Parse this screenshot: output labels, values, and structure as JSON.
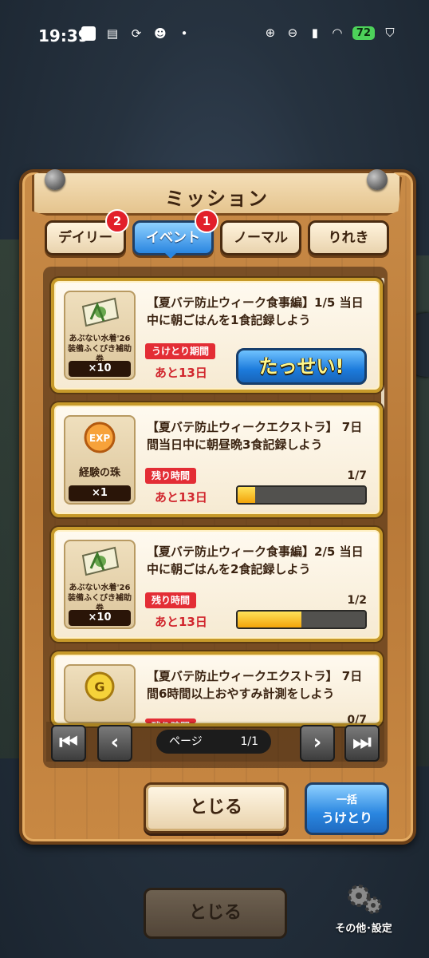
{
  "status_bar": {
    "time": "19:39",
    "battery": "72"
  },
  "dialog": {
    "title": "ミッション",
    "tabs": [
      {
        "label": "デイリー",
        "badge": "2",
        "active": false
      },
      {
        "label": "イベント",
        "badge": "1",
        "active": true
      },
      {
        "label": "ノーマル",
        "active": false
      },
      {
        "label": "りれき",
        "active": false
      }
    ],
    "missions": [
      {
        "reward_name": "あぶない水着'26 装備ふくびき補助券",
        "reward_qty": "×10",
        "text": "【夏バテ防止ウィーク食事編】1/5 当日中に朝ごはんを1食記録しよう",
        "tag": "うけとり期間",
        "remaining": "あと13日",
        "claim_label": "たっせい!",
        "claimable": true
      },
      {
        "reward_name": "経験の珠",
        "reward_qty": "×1",
        "reward_icon_text": "EXP",
        "text": "【夏バテ防止ウィークエクストラ】 7日間当日中に朝昼晩3食記録しよう",
        "tag": "残り時間",
        "remaining": "あと13日",
        "progress_text": "1/7",
        "progress": 0.14
      },
      {
        "reward_name": "あぶない水着'26 装備ふくびき補助券",
        "reward_qty": "×10",
        "text": "【夏バテ防止ウィーク食事編】2/5 当日中に朝ごはんを2食記録しよう",
        "tag": "残り時間",
        "remaining": "あと13日",
        "progress_text": "1/2",
        "progress": 0.5
      },
      {
        "reward_icon_text": "G",
        "text": "【夏バテ防止ウィークエクストラ】 7日間6時間以上おやすみ計測をしよう",
        "tag": "残り時間",
        "progress_text": "0/7"
      }
    ],
    "pager": {
      "label": "ページ",
      "value": "1/1"
    },
    "close_label": "とじる",
    "bulk_line1": "一括",
    "bulk_line2": "うけとり"
  },
  "footer": {
    "close_label": "とじる",
    "settings_label": "その他･設定"
  },
  "colors": {
    "accent_blue": "#2a86e0",
    "badge_red": "#e21f2a",
    "wood": "#c98b47",
    "progress_fill": "#f2a40a"
  }
}
